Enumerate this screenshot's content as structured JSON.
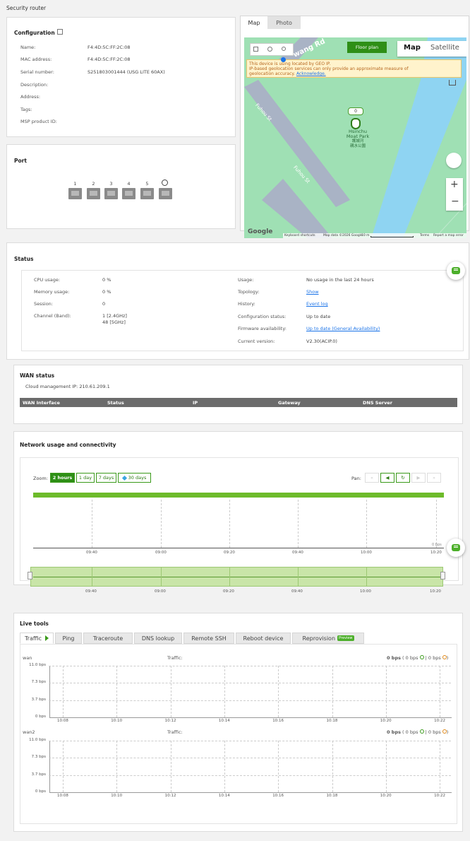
{
  "page": {
    "title": "Security router"
  },
  "config": {
    "title": "Configuration",
    "rows": [
      {
        "label": "Name:",
        "value": "F4:4D:5C:FF:2C:08"
      },
      {
        "label": "MAC address:",
        "value": "F4:4D:5C:FF:2C:08"
      },
      {
        "label": "Serial number:",
        "value": "S251803001444 (USG LITE 60AX)"
      },
      {
        "label": "Description:",
        "value": ""
      },
      {
        "label": "Address:",
        "value": ""
      },
      {
        "label": "Tags:",
        "value": ""
      },
      {
        "label": "MSP product ID:",
        "value": ""
      }
    ]
  },
  "port": {
    "title": "Port",
    "labels": [
      "1",
      "2",
      "3",
      "4",
      "5"
    ]
  },
  "map": {
    "tabs": [
      "Map",
      "Photo"
    ],
    "floor_plan": "Floor plan",
    "map_type": [
      "Map",
      "Satellite"
    ],
    "warning_line1": "This device is using located by GEO IP.",
    "warning_line2": "IP-based geolocation services can only provide an approximate measure of",
    "warning_line3": "geolocation accuracy.",
    "acknowledge": "Acknowledge.",
    "pin_count": "0",
    "park_name": "Hsinchu",
    "park_name2": "Moat Park",
    "park_cn1": "護城河",
    "park_cn2": "親水公園",
    "road1": "Fuhou St",
    "road2": "Fuhou St",
    "road3": "wang Rd",
    "google": "Google",
    "footer": [
      "Keyboard shortcuts",
      "Map data ©2026 Google",
      "10 m",
      "Terms",
      "Report a map error"
    ],
    "zoom_in": "+",
    "zoom_out": "−"
  },
  "status": {
    "title": "Status",
    "left": [
      {
        "label": "CPU usage:",
        "value": "0 %"
      },
      {
        "label": "Memory usage:",
        "value": "0 %"
      },
      {
        "label": "Session:",
        "value": "0"
      },
      {
        "label": "Channel (Band):",
        "value": "1 [2.4GHz]",
        "value2": "48 [5GHz]"
      }
    ],
    "right": [
      {
        "label": "Usage:",
        "value": "No usage in the last 24 hours"
      },
      {
        "label": "Topology:",
        "value": "Show"
      },
      {
        "label": "History:",
        "value": "Event log"
      },
      {
        "label": "Configuration status:",
        "value": "Up to date"
      },
      {
        "label": "Firmware availability:",
        "value": "Up to date (General Availability)"
      },
      {
        "label": "Current version:",
        "value": "V2.30(ACIP.0)"
      }
    ]
  },
  "wan": {
    "title": "WAN status",
    "cloud_ip": "Cloud management IP: 210.61.209.1",
    "headers": [
      "WAN Interface",
      "Status",
      "IP",
      "Gateway",
      "DNS Server"
    ]
  },
  "network": {
    "title": "Network usage and connectivity",
    "zoom_label": "Zoom:",
    "zoom_options": [
      "2 hours",
      "1 day",
      "7 days",
      "30 days"
    ],
    "pan_label": "Pan:",
    "ticks": [
      "09:40",
      "09:00",
      "09:20",
      "09:40",
      "10:00",
      "10:20"
    ],
    "zero_label": "0 bps"
  },
  "live": {
    "title": "Live tools",
    "tabs": [
      "Traffic",
      "Ping",
      "Traceroute",
      "DNS lookup",
      "Remote SSH",
      "Reboot device",
      "Reprovision"
    ],
    "preview_badge": "Preview",
    "charts": [
      {
        "name": "wan",
        "traffic_label": "Traffic:",
        "summary_bold": "0 bps",
        "summary_rest1": " ( 0 bps ",
        "summary_rest2": " | 0 bps ",
        "summary_end": ")"
      },
      {
        "name": "wan2",
        "traffic_label": "Traffic:",
        "summary_bold": "0 bps",
        "summary_rest1": " ( 0 bps ",
        "summary_rest2": " | 0 bps ",
        "summary_end": ")"
      }
    ],
    "y_ticks": [
      "11.0 bps",
      "7.3 bps",
      "3.7 bps",
      "0 bps"
    ],
    "x_ticks": [
      "10:08",
      "10:10",
      "10:12",
      "10:14",
      "10:16",
      "10:18",
      "10:20",
      "10:22"
    ]
  },
  "colors": {
    "accent": "#3a9a1a",
    "bar": "#6dbb2a",
    "range_fill": "#c9e5a8"
  }
}
